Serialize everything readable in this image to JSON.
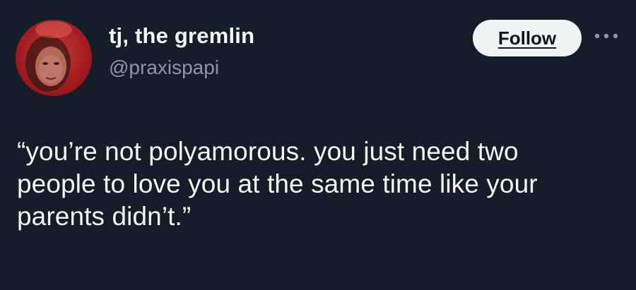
{
  "author": {
    "display_name": "tj, the gremlin",
    "handle": "@praxispapi",
    "avatar_icon": "profile-photo"
  },
  "actions": {
    "follow_label": "Follow",
    "more_icon": "more-horizontal-icon"
  },
  "tweet": {
    "text": "“you’re not polyamorous. you just need two\npeople to love you at the same time like your\nparents didn’t.”"
  },
  "colors": {
    "background": "#151d28",
    "text_primary": "#f4f6f8",
    "text_secondary": "#8b98a5",
    "follow_button_bg": "#eff3f4",
    "avatar_red": "#a81d22"
  }
}
